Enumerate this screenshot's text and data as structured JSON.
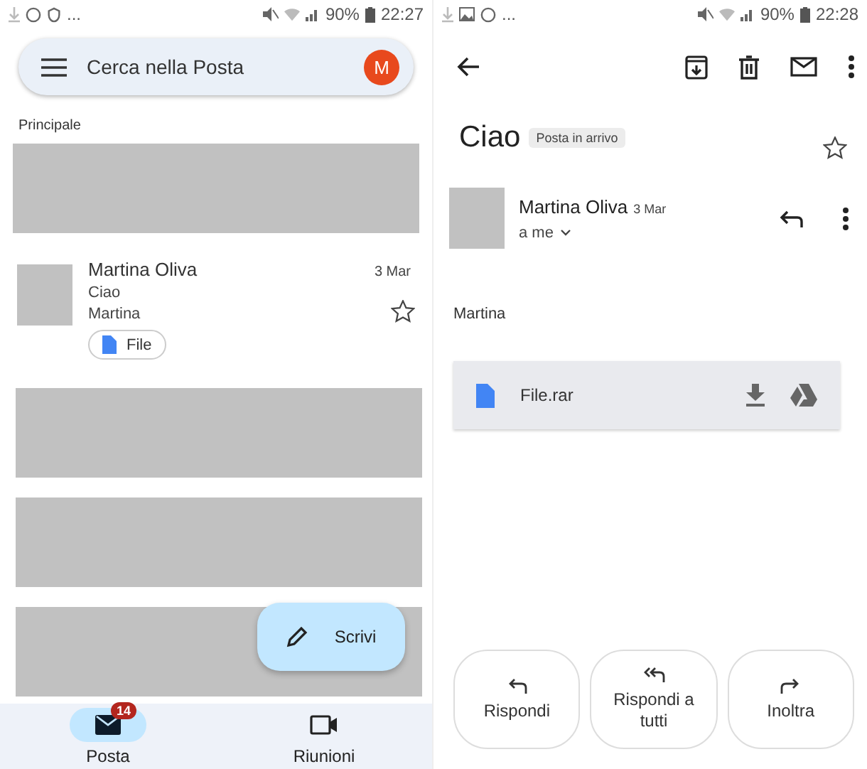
{
  "inbox_screen": {
    "status_bar": {
      "more": "...",
      "battery": "90%",
      "time": "22:27"
    },
    "search": {
      "placeholder": "Cerca nella Posta",
      "avatar": "M"
    },
    "section": "Principale",
    "items": [
      {
        "kind": "redacted"
      },
      {
        "kind": "email",
        "sender": "Martina Oliva",
        "date": "3 Mar",
        "subject": "Ciao",
        "snippet": "Martina",
        "attachment": "File",
        "starred": false
      },
      {
        "kind": "redacted"
      },
      {
        "kind": "redacted"
      },
      {
        "kind": "redacted"
      }
    ],
    "compose": "Scrivi",
    "nav": [
      {
        "label": "Posta",
        "badge": "14",
        "selected": true
      },
      {
        "label": "Riunioni",
        "selected": false
      }
    ]
  },
  "message_screen": {
    "status_bar": {
      "more": "...",
      "battery": "90%",
      "time": "22:28"
    },
    "subject": "Ciao",
    "label": "Posta in arrivo",
    "starred": false,
    "sender": "Martina Oliva",
    "date": "3 Mar",
    "recipient": "a me",
    "body": "Martina",
    "attachment": "File.rar",
    "actions": [
      {
        "label": "Rispondi"
      },
      {
        "label": "Rispondi a tutti"
      },
      {
        "label": "Inoltra"
      }
    ]
  }
}
